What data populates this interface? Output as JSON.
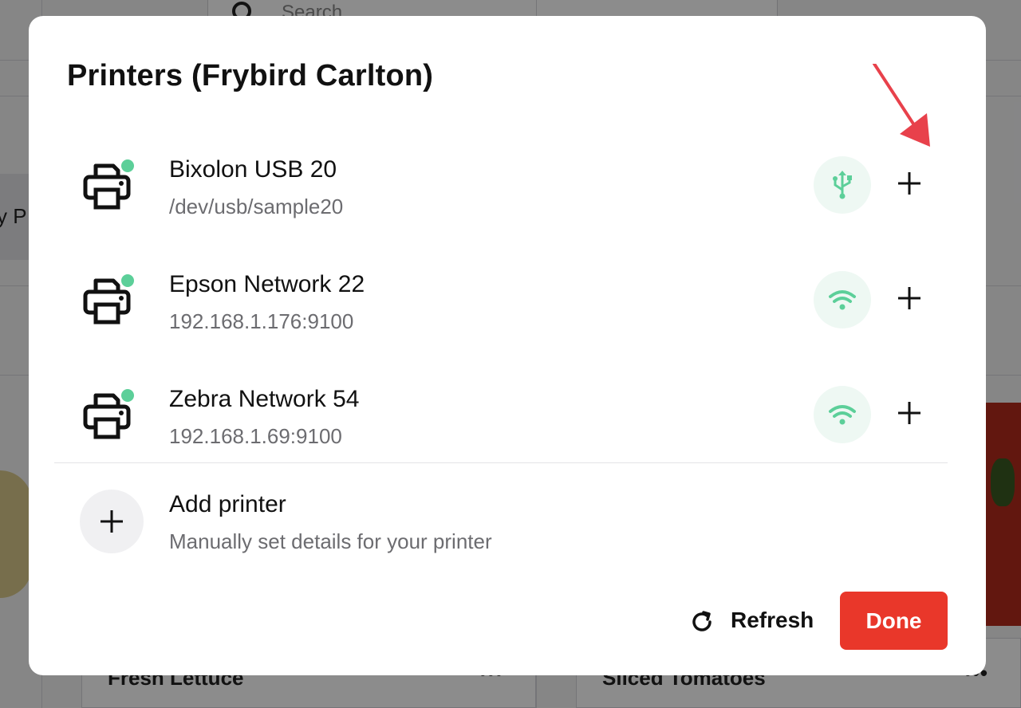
{
  "background": {
    "search_placeholder": "Search",
    "chip_text": "y P",
    "cards": [
      {
        "name": "Fresh Lettuce"
      },
      {
        "name": "Sliced Tomatoes"
      }
    ]
  },
  "modal": {
    "title": "Printers (Frybird Carlton)",
    "printers": [
      {
        "name": "Bixolon USB 20",
        "address": "/dev/usb/sample20",
        "connection": "usb-icon",
        "status": "online"
      },
      {
        "name": "Epson Network 22",
        "address": "192.168.1.176:9100",
        "connection": "wifi-icon",
        "status": "online"
      },
      {
        "name": "Zebra Network 54",
        "address": "192.168.1.69:9100",
        "connection": "wifi-icon",
        "status": "online"
      }
    ],
    "add_printer": {
      "title": "Add printer",
      "subtitle": "Manually set details for your printer"
    },
    "footer": {
      "refresh_label": "Refresh",
      "done_label": "Done"
    }
  },
  "colors": {
    "accent_red": "#e9372a",
    "status_green": "#5ccf99",
    "annotation_arrow": "#e8414b"
  }
}
